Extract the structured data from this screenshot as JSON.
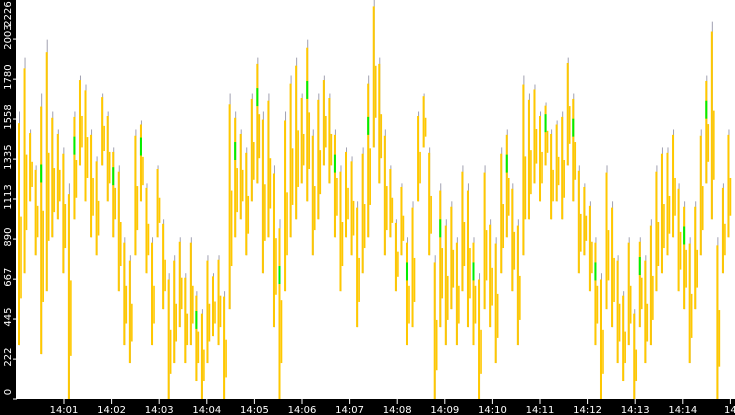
{
  "chart_data": {
    "type": "bar",
    "subtype": "range-bars",
    "title": "",
    "xlabel": "",
    "ylabel": "",
    "ylim": [
      0,
      2226
    ],
    "yticks": [
      "0",
      "222",
      "445",
      "667",
      "890",
      "1113",
      "1335",
      "1558",
      "1780",
      "2003",
      "2226"
    ],
    "xticks": [
      "14:01",
      "14:02",
      "14:03",
      "14:04",
      "14:05",
      "14:06",
      "14:07",
      "14:08",
      "14:09",
      "14:10",
      "14:11",
      "14:12",
      "14:13",
      "14:14",
      "14"
    ],
    "grid": false,
    "colors": {
      "range": "#ffc800",
      "highlight": "#00ee00",
      "wick": "#a0a0b0",
      "axis": "#000000"
    },
    "low": [
      300,
      700,
      1100,
      800,
      250,
      600,
      900,
      1000,
      700,
      0,
      1000,
      1300,
      1100,
      900,
      800,
      1300,
      1100,
      900,
      600,
      300,
      200,
      800,
      1100,
      700,
      300,
      900,
      500,
      0,
      200,
      400,
      200,
      300,
      100,
      0,
      200,
      350,
      300,
      0,
      500,
      900,
      1000,
      800,
      1100,
      1200,
      700,
      900,
      400,
      0,
      600,
      900,
      1000,
      1200,
      1100,
      800,
      1000,
      1300,
      1200,
      900,
      600,
      900,
      800,
      400,
      700,
      900,
      1400,
      1200,
      800,
      900,
      600,
      800,
      300,
      400,
      1100,
      1400,
      800,
      0,
      400,
      300,
      500,
      300,
      600,
      400,
      300,
      0,
      500,
      400,
      200,
      700,
      900,
      600,
      300,
      800,
      1000,
      1200,
      1100,
      1300,
      1000,
      1100,
      1000,
      1300,
      1100,
      700,
      800,
      600,
      300,
      0,
      500,
      400,
      200,
      100,
      300,
      0,
      400,
      200,
      300,
      600,
      700,
      800,
      900,
      600,
      500,
      200,
      500,
      800,
      1200,
      1000,
      0,
      700,
      900
    ],
    "high": [
      1600,
      1900,
      1500,
      1300,
      1700,
      2000,
      1600,
      1500,
      1400,
      1200,
      1600,
      1800,
      1750,
      1500,
      1350,
      1700,
      1600,
      1400,
      1300,
      900,
      800,
      1500,
      1550,
      1200,
      900,
      1300,
      1000,
      700,
      800,
      900,
      700,
      900,
      600,
      500,
      800,
      700,
      800,
      600,
      1700,
      1600,
      1500,
      1400,
      1700,
      1900,
      1600,
      1700,
      1300,
      1000,
      1600,
      1800,
      1900,
      1700,
      2000,
      1500,
      1700,
      1800,
      1700,
      1500,
      1300,
      1400,
      1350,
      1100,
      1400,
      1800,
      2226,
      1900,
      1500,
      1300,
      1000,
      1200,
      900,
      1100,
      1600,
      1700,
      1400,
      800,
      1200,
      1000,
      1100,
      900,
      1300,
      1200,
      900,
      700,
      1300,
      1000,
      900,
      1400,
      1500,
      1200,
      1000,
      1800,
      1700,
      1750,
      1600,
      1650,
      1500,
      1550,
      1600,
      1900,
      1700,
      1300,
      1200,
      1100,
      900,
      700,
      1300,
      1100,
      800,
      600,
      900,
      500,
      900,
      800,
      1000,
      1300,
      1400,
      1400,
      1500,
      1200,
      1100,
      900,
      1100,
      1500,
      1800,
      2100,
      900,
      1200,
      1500
    ],
    "highlight_bars": [
      4,
      10,
      17,
      22,
      32,
      39,
      43,
      47,
      52,
      57,
      63,
      70,
      76,
      82,
      88,
      95,
      100,
      104,
      112,
      120,
      124
    ]
  }
}
